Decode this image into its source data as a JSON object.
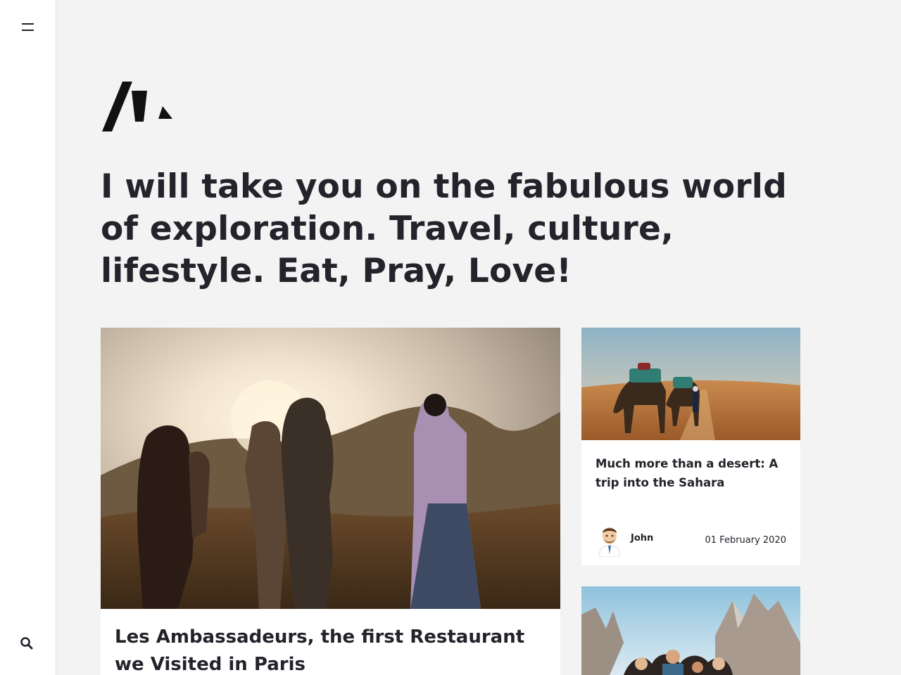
{
  "sidebar": {
    "menu_icon": "hamburger-menu-icon",
    "search_icon": "search-icon"
  },
  "brand": {
    "logo_icon": "brand-logo-icon"
  },
  "hero": {
    "headline": "I will take you on the fabulous world of exploration. Travel, culture, lifestyle. Eat, Pray, Love!"
  },
  "posts": {
    "featured": {
      "title": "Les Ambassadeurs, the first Restaurant we Visited in Paris",
      "image": "group-sunset-hills-photo"
    },
    "side": [
      {
        "title": "Much more than a desert: A trip into the Sahara",
        "image": "camels-desert-photo",
        "author": "John",
        "date": "01 February 2020"
      },
      {
        "image": "friends-mountains-photo"
      }
    ]
  },
  "colors": {
    "page_background": "#f3f3f3",
    "text": "#23232b",
    "card_background": "#ffffff"
  }
}
